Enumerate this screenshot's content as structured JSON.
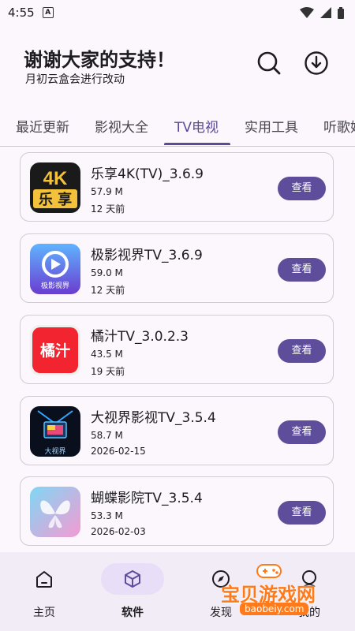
{
  "status_bar": {
    "time": "4:55",
    "a_icon": "A"
  },
  "header": {
    "title": "谢谢大家的支持！",
    "subtitle": "月初云盒会进行改动"
  },
  "tabs": [
    {
      "label": "最近更新"
    },
    {
      "label": "影视大全"
    },
    {
      "label": "TV电视"
    },
    {
      "label": "实用工具"
    },
    {
      "label": "听歌娱"
    }
  ],
  "apps": [
    {
      "name": "乐享4K(TV)_3.6.9",
      "size": "57.9 M",
      "date": "12 天前",
      "button": "查看",
      "icon": "lexiang-4k-icon"
    },
    {
      "name": "极影视界TV_3.6.9",
      "size": "59.0 M",
      "date": "12 天前",
      "button": "查看",
      "icon": "jiying-shijie-icon",
      "icon_text": "极影视界"
    },
    {
      "name": "橘汁TV_3.0.2.3",
      "size": "43.5 M",
      "date": "19 天前",
      "button": "查看",
      "icon": "juzhi-icon",
      "icon_text": "橘汁"
    },
    {
      "name": "大视界影视TV_3.5.4",
      "size": "58.7 M",
      "date": "2026-02-15",
      "button": "查看",
      "icon": "dashijie-icon",
      "icon_text": "大视界"
    },
    {
      "name": "蝴蝶影院TV_3.5.4",
      "size": "53.3 M",
      "date": "2026-02-03",
      "button": "查看",
      "icon": "butterfly-icon"
    }
  ],
  "bottom_nav": [
    {
      "label": "主页",
      "icon": "home-icon"
    },
    {
      "label": "软件",
      "icon": "software-cube-icon"
    },
    {
      "label": "发现",
      "icon": "compass-icon"
    },
    {
      "label": "我的",
      "icon": "profile-icon"
    }
  ],
  "watermark": {
    "title": "宝贝游戏网",
    "url": "baobeiy.com"
  },
  "colors": {
    "accent": "#5d4d9a",
    "background": "#fbf7fd",
    "nav_active_pill": "#e8def8"
  }
}
